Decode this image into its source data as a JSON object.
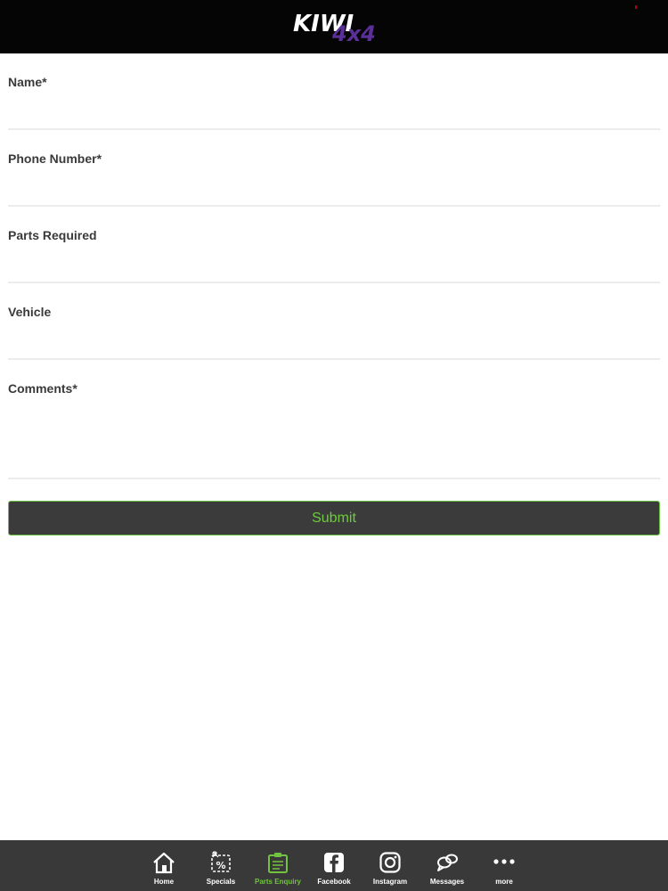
{
  "header": {
    "logo_main": "KIWI",
    "logo_sub": "4x4"
  },
  "form": {
    "name_label": "Name*",
    "phone_label": "Phone Number*",
    "parts_label": "Parts Required",
    "vehicle_label": "Vehicle",
    "comments_label": "Comments*",
    "submit_label": "Submit"
  },
  "tabbar": {
    "tabs": [
      {
        "label": "Home",
        "icon": "home-icon"
      },
      {
        "label": "Specials",
        "icon": "specials-icon"
      },
      {
        "label": "Parts Enquiry",
        "icon": "parts-enquiry-icon",
        "active": true
      },
      {
        "label": "Facebook",
        "icon": "facebook-icon"
      },
      {
        "label": "Instagram",
        "icon": "instagram-icon"
      },
      {
        "label": "Messages",
        "icon": "messages-icon"
      },
      {
        "label": "more",
        "icon": "more-icon"
      }
    ]
  },
  "colors": {
    "header_bg": "#050506",
    "accent_green": "#6dcc3c",
    "logo_purple": "#5a2f97",
    "tabbar_bg": "#393939",
    "button_bg": "#3b3b3b"
  }
}
